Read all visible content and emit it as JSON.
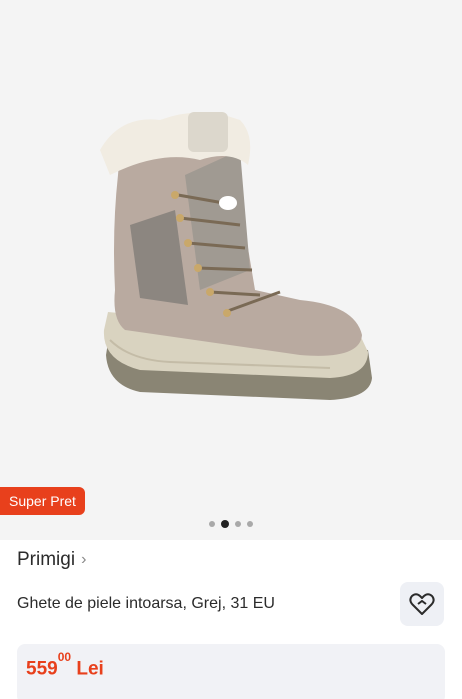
{
  "badge": {
    "label": "Super Pret"
  },
  "gallery": {
    "image_count": 4,
    "active_index": 1
  },
  "product": {
    "brand": "Primigi",
    "title": "Ghete de piele intoarsa, Grej, 31 EU",
    "price_int": "559",
    "price_dec": "00",
    "currency": "Lei"
  },
  "icons": {
    "brand_chevron": "chevron-right-icon",
    "favorite": "heart-icon"
  },
  "colors": {
    "accent": "#e8401c",
    "text": "#2b2b2b"
  }
}
